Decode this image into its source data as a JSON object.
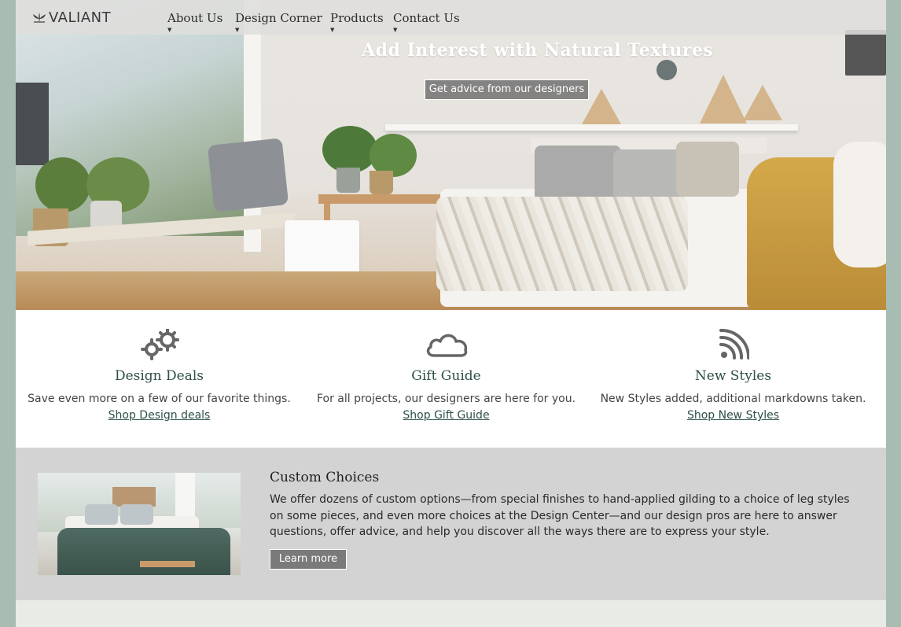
{
  "brand": {
    "logo_text": "VALIANT"
  },
  "nav": {
    "items": [
      {
        "label": "About Us"
      },
      {
        "label": "Design Corner"
      },
      {
        "label": "Products"
      },
      {
        "label": "Contact Us"
      }
    ]
  },
  "hero": {
    "title": "Add Interest with Natural Textures",
    "cta_label": "Get advice from our designers"
  },
  "features": [
    {
      "icon": "gears-icon",
      "title": "Design Deals",
      "text": "Save even more on a few of our favorite things.",
      "link": "Shop Design deals"
    },
    {
      "icon": "cloud-icon",
      "title": "Gift Guide",
      "text": "For all projects, our designers are here for you.",
      "link": "Shop Gift Guide"
    },
    {
      "icon": "rss-icon",
      "title": "New Styles",
      "text": "New Styles added, additional markdowns taken.",
      "link": "Shop New Styles"
    }
  ],
  "custom": {
    "title": "Custom Choices",
    "text": "We offer dozens of custom options—from special finishes to hand-applied gilding to a choice of leg styles on some pieces, and even more choices at the Design Center—and our design pros are here to answer questions, offer advice, and help you discover all the ways there are to express your style.",
    "button_label": "Learn more"
  },
  "colors": {
    "accent_teal": "#2e4f4a",
    "frame_sage": "#a8bcb3",
    "band_grey": "#d3d3d3"
  }
}
